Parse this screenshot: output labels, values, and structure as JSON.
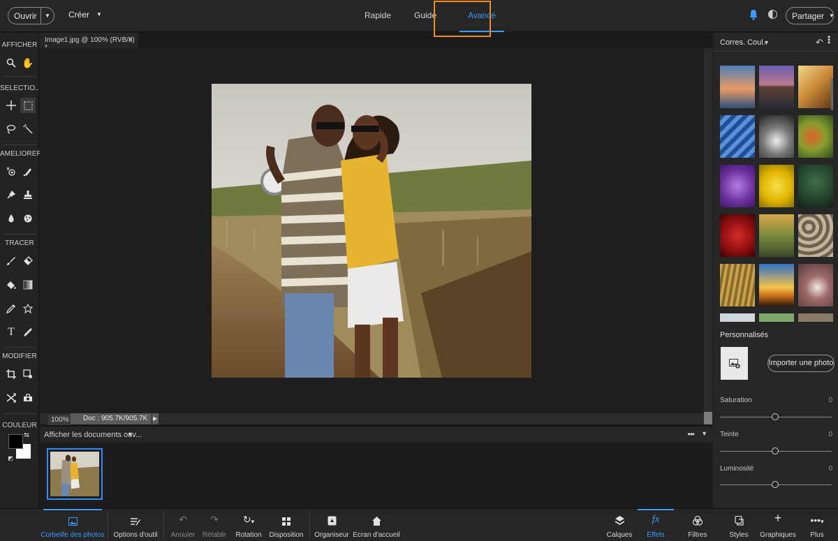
{
  "topbar": {
    "open_label": "Ouvrir",
    "create_label": "Créer",
    "modes": [
      {
        "label": "Rapide"
      },
      {
        "label": "Guidé"
      },
      {
        "label": "Avancé"
      }
    ],
    "active_mode": "Avancé",
    "share_label": "Partager",
    "colors": {
      "accent": "#3d9bff",
      "highlight": "#f08b26"
    }
  },
  "toolbar": {
    "sections": {
      "view": "AFFICHER",
      "select": "SELECTIO...",
      "enhance": "AMELIORER",
      "draw": "TRACER",
      "modify": "MODIFIER",
      "color": "COULEUR"
    }
  },
  "document": {
    "tab_title": "Image1.jpg @ 100% (RVB/8) *",
    "tab_close": "×",
    "zoom": "100%",
    "doc_info": "Doc : 905.7K/905.7K"
  },
  "photo_bin": {
    "header_label": "Afficher les documents ouv..."
  },
  "panel": {
    "title": "Corres. Coul.",
    "custom_label": "Personnalisés",
    "import_label": "Importer une photo",
    "sliders": [
      {
        "label": "Saturation",
        "value": "0"
      },
      {
        "label": "Teinte",
        "value": "0"
      },
      {
        "label": "Luminosité",
        "value": "0"
      }
    ]
  },
  "taskbar": {
    "items_left": [
      {
        "label": "Corbeille des photos"
      },
      {
        "label": "Options d'outil"
      },
      {
        "label": "Annuler"
      },
      {
        "label": "Rétablir"
      },
      {
        "label": "Rotation"
      },
      {
        "label": "Disposition"
      },
      {
        "label": "Organiseur"
      },
      {
        "label": "Ecran d'accueil"
      }
    ],
    "items_right": [
      {
        "label": "Calques"
      },
      {
        "label": "Effets"
      },
      {
        "label": "Filtres"
      },
      {
        "label": "Styles"
      },
      {
        "label": "Graphiques"
      },
      {
        "label": "Plus"
      }
    ]
  }
}
